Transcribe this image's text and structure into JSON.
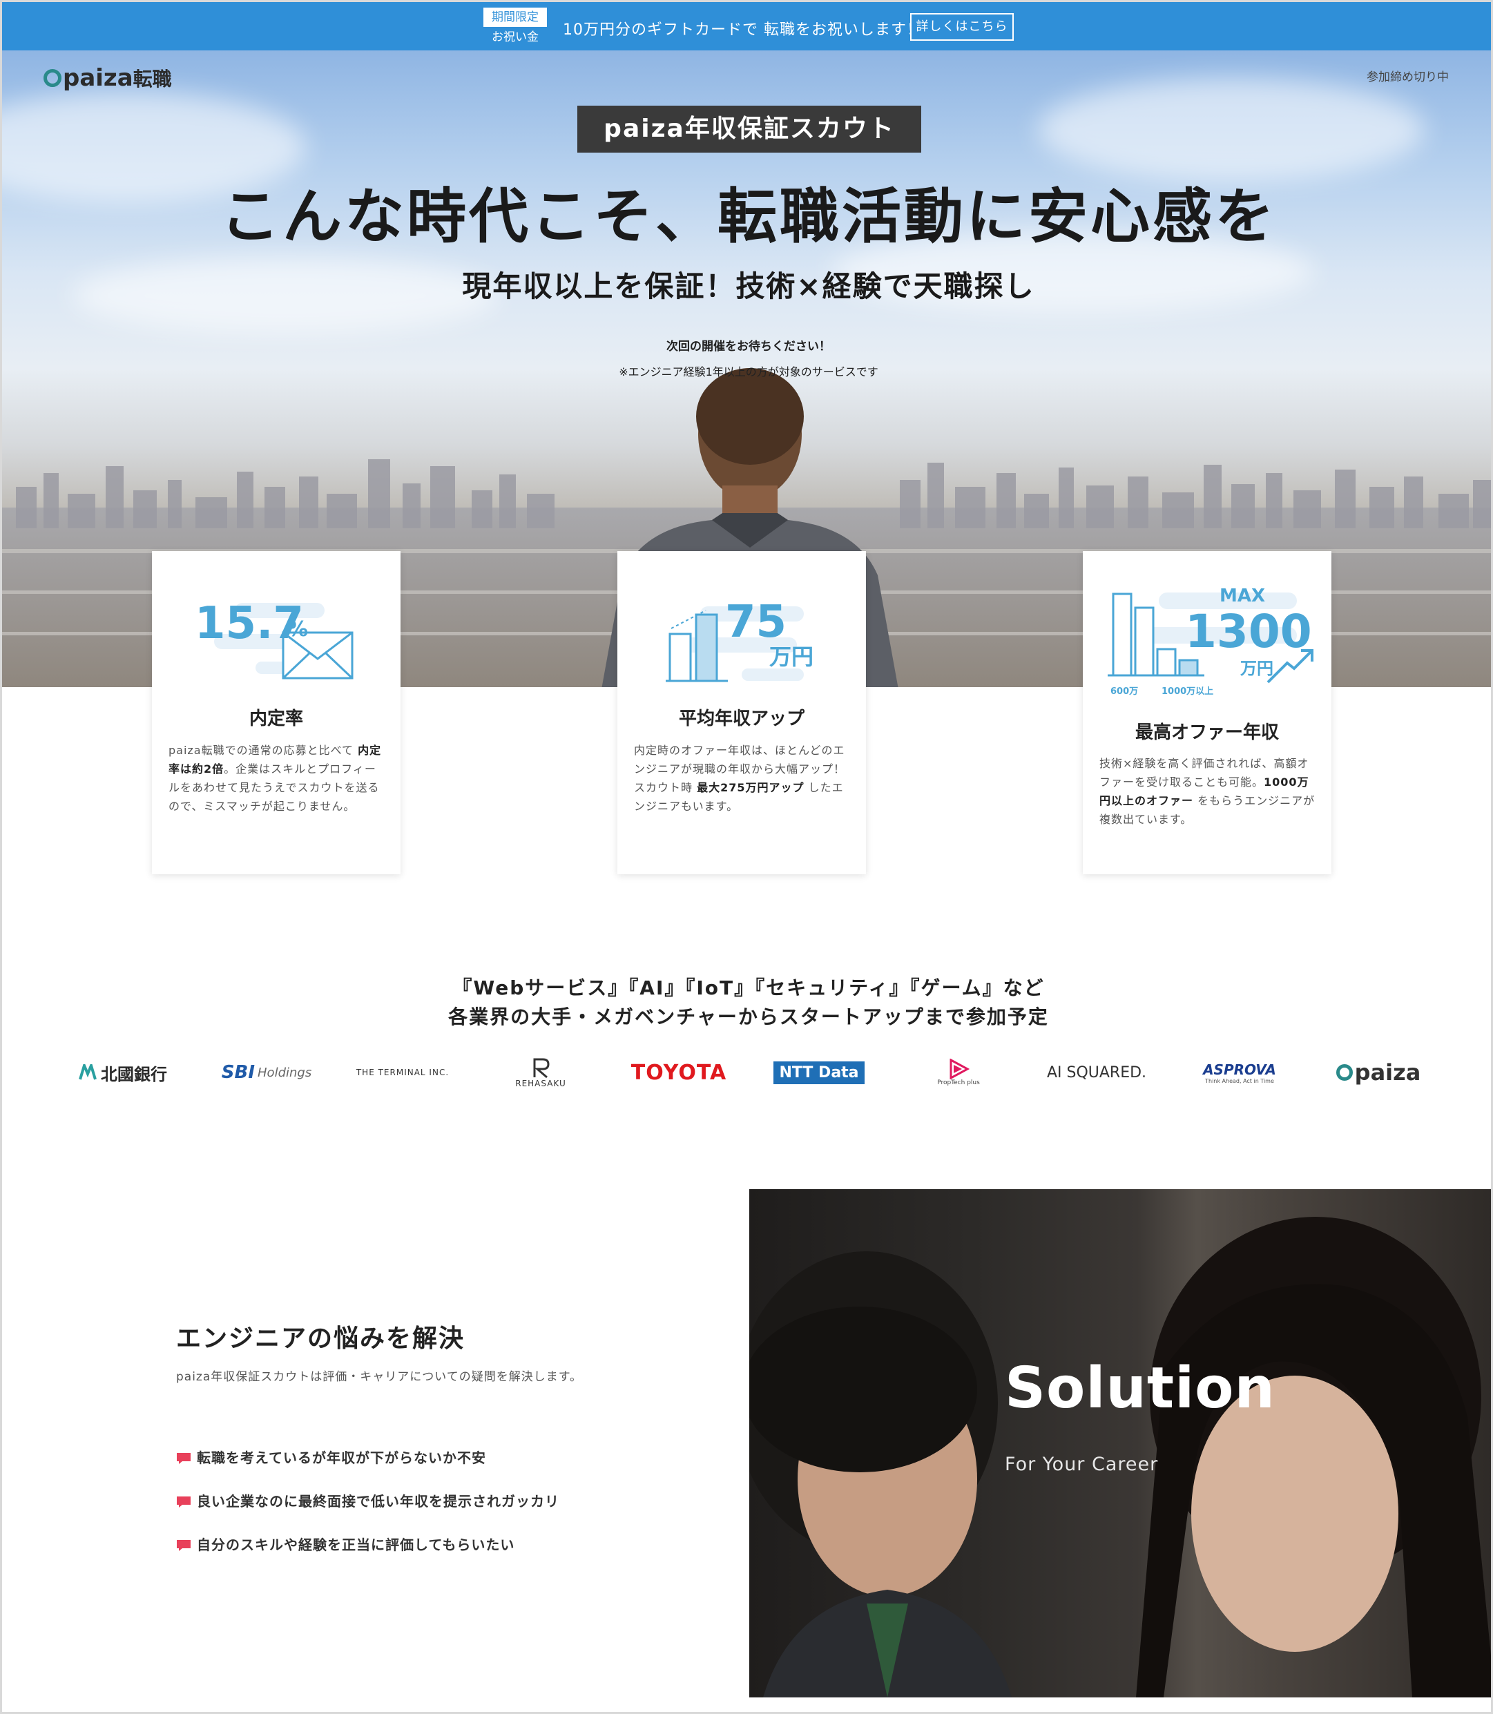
{
  "promo": {
    "badge_top": "期間限定",
    "badge_bottom": "お祝い金",
    "text": "10万円分のギフトカードで 転職をお祝いします！",
    "button": "詳しくはこちら"
  },
  "header": {
    "logo": "paiza",
    "logo_sub": "転職",
    "status": "参加締め切り中"
  },
  "hero": {
    "tag": "paiza年収保証スカウト",
    "title": "こんな時代こそ、転職活動に安心感を",
    "subtitle": "現年収以上を保証！技術×経験で天職探し",
    "note1": "次回の開催をお待ちください！",
    "note2": "※エンジニア経験1年以上の方が対象のサービスです"
  },
  "cards": [
    {
      "number": "15.7",
      "unit": "%",
      "title": "内定率",
      "body_parts": [
        "paiza転職での通常の応募と比べて ",
        "内定率は約2倍",
        "。企業はスキルとプロフィールをあわせて見たうえでスカウトを送るので、ミスマッチが起こりません。"
      ]
    },
    {
      "number": "75",
      "unit": "万円",
      "title": "平均年収アップ",
      "body_parts": [
        "内定時のオファー年収は、ほとんどのエンジニアが現職の年収から大幅アップ！スカウト時 ",
        "最大275万円アップ",
        " したエンジニアもいます。"
      ]
    },
    {
      "max": "MAX",
      "number": "1300",
      "unit": "万円",
      "axis_a": "600万",
      "axis_b": "1000万以上",
      "title": "最高オファー年収",
      "body_parts": [
        "技術×経験を高く評価されれば、高額オファーを受け取ることも可能。",
        "1000万円以上のオファー",
        " をもらうエンジニアが複数出ています。"
      ]
    }
  ],
  "industries": {
    "line1": "『Webサービス』『AI』『IoT』『セキュリティ』『ゲーム』など",
    "line2": "各業界の大手・メガベンチャーからスタートアップまで参加予定"
  },
  "company_logos": [
    {
      "name": "北國銀行"
    },
    {
      "name": "SBI",
      "sub": "Holdings"
    },
    {
      "name": "THE TERMINAL INC."
    },
    {
      "name": "REHASAKU"
    },
    {
      "name": "TOYOTA"
    },
    {
      "name": "NTT Data"
    },
    {
      "name": "PropTech plus"
    },
    {
      "name": "AI SQUARED."
    },
    {
      "name": "ASPROVA",
      "sub": "Think Ahead, Act in Time"
    },
    {
      "name": "paiza"
    }
  ],
  "solution": {
    "heading": "エンジニアの悩みを解決",
    "subheading": "paiza年収保証スカウトは評価・キャリアについての疑問を解決します。",
    "pains": [
      "転職を考えているが年収が下がらないか不安",
      "良い企業なのに最終面接で低い年収を提示されガッカリ",
      "自分のスキルや経験を正当に評価してもらいたい"
    ],
    "photo_title": "Solution",
    "photo_caption": "For Your Career"
  },
  "colors": {
    "promo_bar": "#2f8fd8",
    "accent_blue": "#4aa6d6",
    "pain_icon": "#e8405a",
    "logo_teal": "#2a8a8a",
    "toyota_red": "#e0191e",
    "nttdata_blue": "#1f6fb6"
  }
}
